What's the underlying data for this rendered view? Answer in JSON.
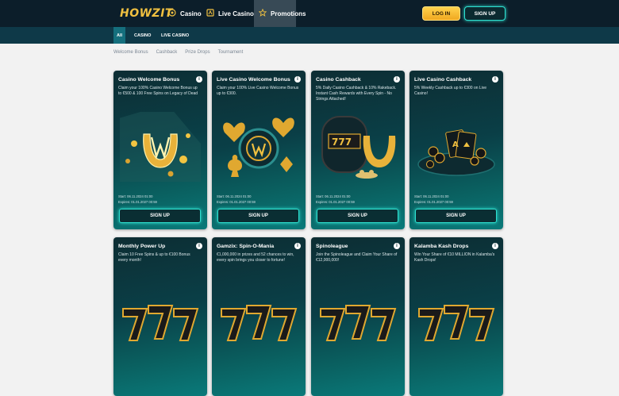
{
  "header": {
    "logo": "HOWZIT",
    "nav": [
      {
        "label": "Casino",
        "icon": "casino-chip-icon"
      },
      {
        "label": "Live Casino",
        "icon": "live-casino-icon"
      },
      {
        "label": "Promotions",
        "icon": "star-icon"
      }
    ],
    "login_label": "LOG IN",
    "signup_label": "SIGN UP"
  },
  "subnav": [
    "All",
    "CASINO",
    "LIVE CASINO"
  ],
  "filters": [
    "Welcome Bonus",
    "Cashback",
    "Prize Drops",
    "Tournament"
  ],
  "cards": [
    {
      "title": "Casino Welcome Bonus",
      "desc": "Claim your 100% Casino Welcome Bonus up to €500 & 100 Free Spins on Legacy of Dead",
      "start": "Start: 06.11.2024 01:00",
      "expires": "Expires: 01.01.2027 00:59",
      "button": "SIGN UP"
    },
    {
      "title": "Live Casino Welcome Bonus",
      "desc": "Claim your 100% Live Casino Welcome Bonus up to €300.",
      "start": "Start: 06.11.2024 01:00",
      "expires": "Expires: 01.01.2027 00:59",
      "button": "SIGN UP"
    },
    {
      "title": "Casino Cashback",
      "desc": "5% Daily Casino Cashback & 10% Rakeback. Instant Cash Rewards with Every Spin - No Strings Attached!",
      "start": "Start: 06.11.2024 01:00",
      "expires": "Expires: 01.01.2027 00:59",
      "button": "SIGN UP"
    },
    {
      "title": "Live Casino Cashback",
      "desc": "5% Weekly Cashback up to €300 on Live Casino!",
      "start": "Start: 06.11.2024 01:00",
      "expires": "Expires: 01.01.2027 00:59",
      "button": "SIGN UP"
    },
    {
      "title": "Monthly Power Up",
      "desc": "Claim 10 Free Spins & up to €100 Bonus every month!"
    },
    {
      "title": "Gamzix: Spin-O-Mania",
      "desc": "€1,000,000 in prizes and 52 chances to win, every spin brings you closer to fortune!"
    },
    {
      "title": "Spinoleague",
      "desc": "Join the Spinoleague and Claim Your Share of €12,000,000!"
    },
    {
      "title": "Kalamba Kash Drops",
      "desc": "Win Your Share of €10 MILLION in Kalamba's Kash Drops!"
    }
  ]
}
